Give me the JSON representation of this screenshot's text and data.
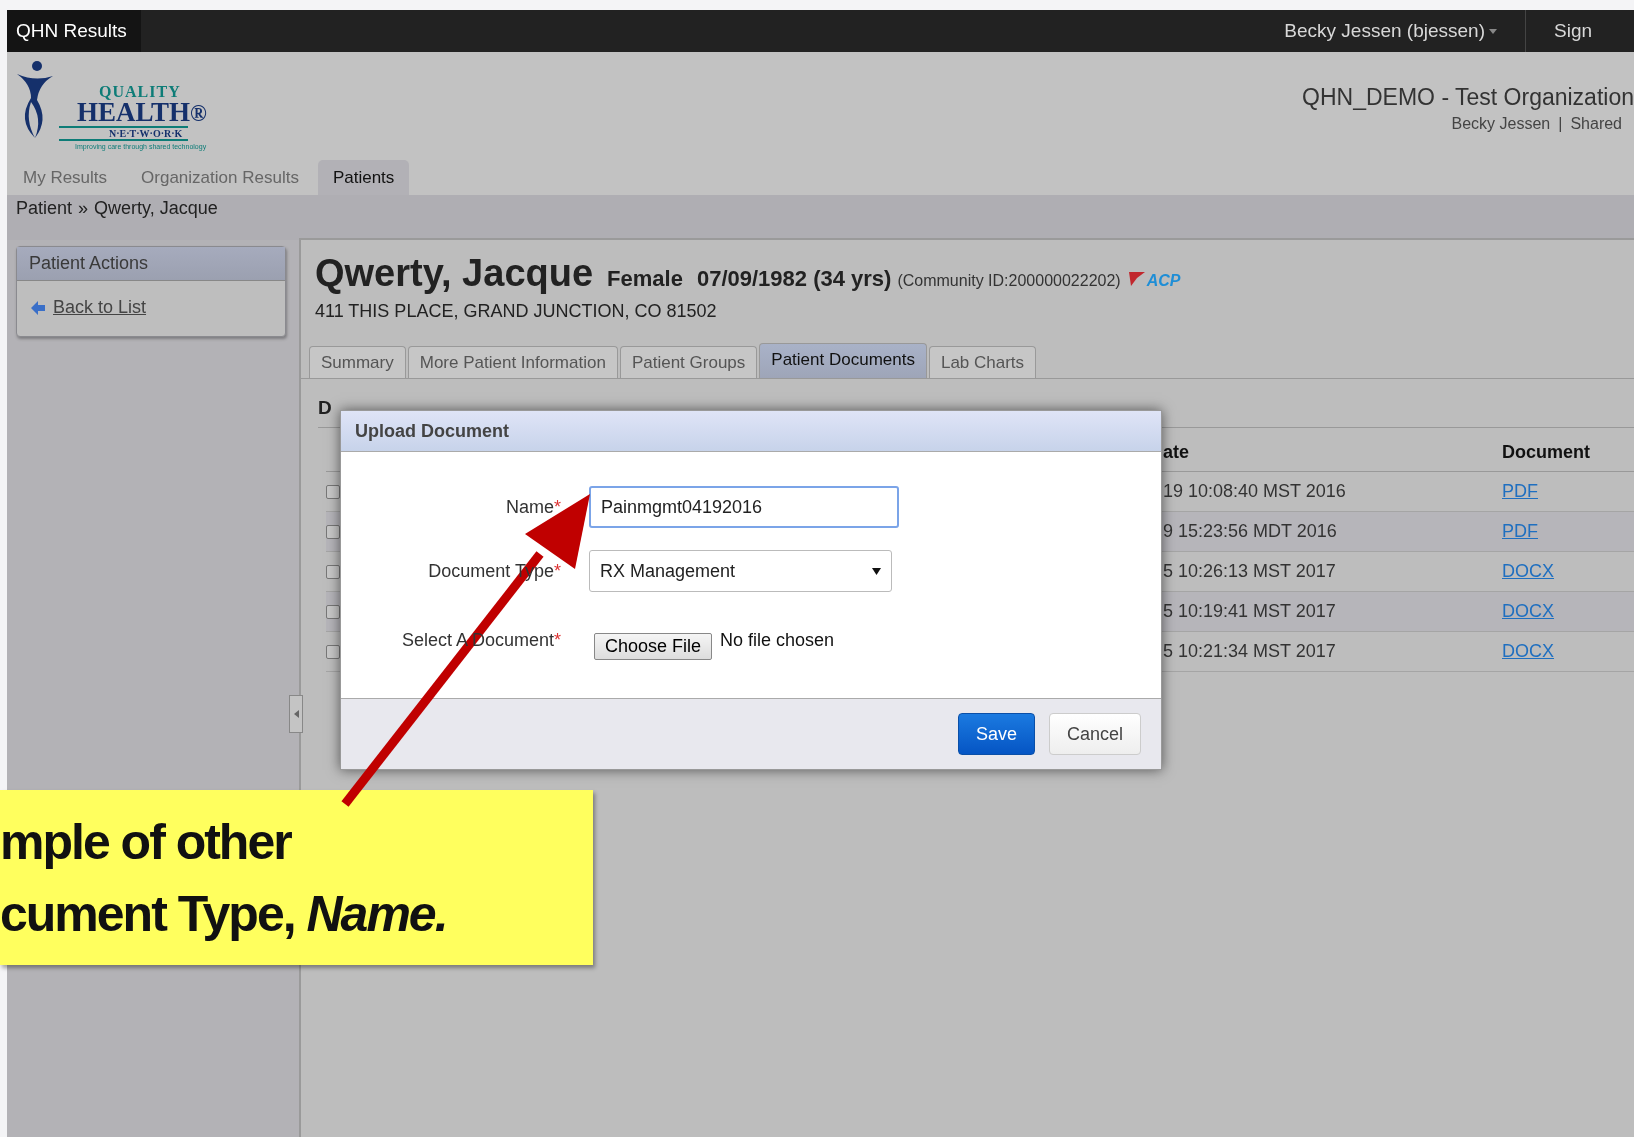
{
  "app_bar": {
    "title": "QHN Results",
    "user_menu": "Becky Jessen (bjessen)",
    "sign_out": "Sign"
  },
  "logo": {
    "line_1": "QUALITY",
    "line_2": "HEALTH",
    "mark": "®",
    "line_3": "N·E·T·W·O·R·K",
    "tagline": "Improving care through shared technology"
  },
  "header": {
    "organization": "QHN_DEMO - Test Organization",
    "user": "Becky Jessen",
    "separator": "|",
    "shared": "Shared"
  },
  "nav_tabs": [
    {
      "label": "My Results",
      "selected": false
    },
    {
      "label": "Organization Results",
      "selected": false
    },
    {
      "label": "Patients",
      "selected": true
    }
  ],
  "breadcrumb": {
    "root": "Patient",
    "separator": "»",
    "current": "Qwerty, Jacque"
  },
  "sidebar": {
    "title": "Patient Actions",
    "items": [
      {
        "label": "Back to List"
      }
    ]
  },
  "patient": {
    "name": "Qwerty, Jacque",
    "sex": "Female",
    "dob": "07/09/1982 (34 yrs)",
    "community_id": "(Community ID:200000022202)",
    "badge": "ACP",
    "address": "411 THIS PLACE, GRAND JUNCTION, CO 81502"
  },
  "patient_tabs": [
    {
      "label": "Summary",
      "selected": false
    },
    {
      "label": "More Patient Information",
      "selected": false
    },
    {
      "label": "Patient Groups",
      "selected": false
    },
    {
      "label": "Patient Documents",
      "selected": true
    },
    {
      "label": "Lab Charts",
      "selected": false
    }
  ],
  "documents": {
    "heading": "D",
    "columns": [
      "ate",
      "Document"
    ],
    "rows": [
      {
        "checked": false,
        "date": "19 10:08:40 MST 2016",
        "document": "PDF"
      },
      {
        "checked": false,
        "date": "9 15:23:56 MDT 2016",
        "document": "PDF"
      },
      {
        "checked": false,
        "date": "5 10:26:13 MST 2017",
        "document": "DOCX"
      },
      {
        "checked": false,
        "date": "5 10:19:41 MST 2017",
        "document": "DOCX"
      },
      {
        "checked": false,
        "date": "5 10:21:34 MST 2017",
        "document": "DOCX"
      }
    ]
  },
  "dialog": {
    "title": "Upload Document",
    "fields": [
      {
        "kind": "text",
        "label": "Name",
        "required_mark": "*",
        "value": "Painmgmt04192016"
      },
      {
        "kind": "select",
        "label": "Document Type",
        "required_mark": "*",
        "value": "RX Management"
      },
      {
        "kind": "file",
        "label": "Select A Document",
        "required_mark": "*",
        "button": "Choose File",
        "status": "No file chosen"
      }
    ],
    "buttons": [
      {
        "label": "Save",
        "primary": true
      },
      {
        "label": "Cancel",
        "primary": false
      }
    ]
  },
  "callout": {
    "lines": [
      "mple of other",
      "cument Type, *Name.*"
    ]
  }
}
